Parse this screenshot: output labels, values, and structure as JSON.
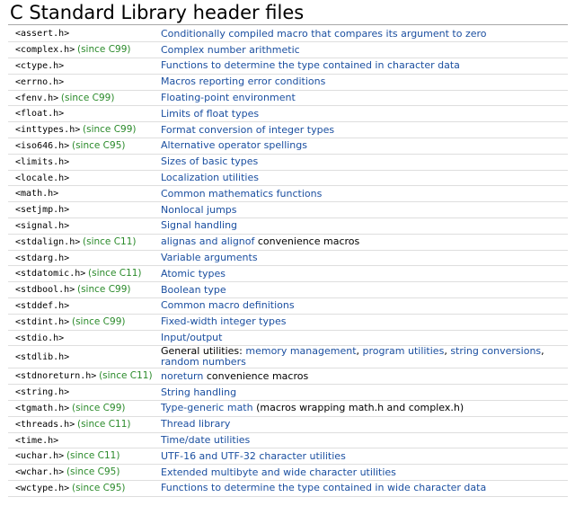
{
  "title": "C Standard Library header files",
  "colors": {
    "link": "#1b4fa0",
    "since": "#2a8a2a",
    "text": "#000000"
  },
  "headers": [
    {
      "name": "<assert.h>",
      "since": "",
      "desc": [
        {
          "t": "Conditionally compiled macro that compares its argument to zero",
          "link": true
        }
      ]
    },
    {
      "name": "<complex.h>",
      "since": "(since C99)",
      "desc": [
        {
          "t": "Complex number arithmetic",
          "link": true
        }
      ]
    },
    {
      "name": "<ctype.h>",
      "since": "",
      "desc": [
        {
          "t": "Functions to determine the type contained in character data",
          "link": true
        }
      ]
    },
    {
      "name": "<errno.h>",
      "since": "",
      "desc": [
        {
          "t": "Macros reporting error conditions",
          "link": true
        }
      ]
    },
    {
      "name": "<fenv.h>",
      "since": "(since C99)",
      "desc": [
        {
          "t": "Floating-point environment",
          "link": true
        }
      ]
    },
    {
      "name": "<float.h>",
      "since": "",
      "desc": [
        {
          "t": "Limits of float types",
          "link": true
        }
      ]
    },
    {
      "name": "<inttypes.h>",
      "since": "(since C99)",
      "desc": [
        {
          "t": "Format conversion of integer types",
          "link": true
        }
      ]
    },
    {
      "name": "<iso646.h>",
      "since": "(since C95)",
      "desc": [
        {
          "t": "Alternative operator spellings",
          "link": true
        }
      ]
    },
    {
      "name": "<limits.h>",
      "since": "",
      "desc": [
        {
          "t": "Sizes of basic types",
          "link": true
        }
      ]
    },
    {
      "name": "<locale.h>",
      "since": "",
      "desc": [
        {
          "t": "Localization utilities",
          "link": true
        }
      ]
    },
    {
      "name": "<math.h>",
      "since": "",
      "desc": [
        {
          "t": "Common mathematics functions",
          "link": true
        }
      ]
    },
    {
      "name": "<setjmp.h>",
      "since": "",
      "desc": [
        {
          "t": "Nonlocal jumps",
          "link": true
        }
      ]
    },
    {
      "name": "<signal.h>",
      "since": "",
      "desc": [
        {
          "t": "Signal handling",
          "link": true
        }
      ]
    },
    {
      "name": "<stdalign.h>",
      "since": "(since C11)",
      "desc": [
        {
          "t": "alignas and alignof",
          "link": true
        },
        {
          "t": " convenience macros",
          "link": false
        }
      ]
    },
    {
      "name": "<stdarg.h>",
      "since": "",
      "desc": [
        {
          "t": "Variable arguments",
          "link": true
        }
      ]
    },
    {
      "name": "<stdatomic.h>",
      "since": "(since C11)",
      "desc": [
        {
          "t": "Atomic types",
          "link": true
        }
      ]
    },
    {
      "name": "<stdbool.h>",
      "since": "(since C99)",
      "desc": [
        {
          "t": "Boolean type",
          "link": true
        }
      ]
    },
    {
      "name": "<stddef.h>",
      "since": "",
      "desc": [
        {
          "t": "Common macro definitions",
          "link": true
        }
      ]
    },
    {
      "name": "<stdint.h>",
      "since": "(since C99)",
      "desc": [
        {
          "t": "Fixed-width integer types",
          "link": true
        }
      ]
    },
    {
      "name": "<stdio.h>",
      "since": "",
      "desc": [
        {
          "t": "Input/output",
          "link": true
        }
      ]
    },
    {
      "name": "<stdlib.h>",
      "since": "",
      "tall": true,
      "desc": [
        {
          "t": "General utilities: ",
          "link": false
        },
        {
          "t": "memory management",
          "link": true
        },
        {
          "t": ", ",
          "link": false
        },
        {
          "t": "program utilities",
          "link": true
        },
        {
          "t": ", ",
          "link": false
        },
        {
          "t": "string conversions",
          "link": true
        },
        {
          "t": ", ",
          "link": false
        },
        {
          "t": "random numbers",
          "link": true
        }
      ]
    },
    {
      "name": "<stdnoreturn.h>",
      "since": "(since C11)",
      "desc": [
        {
          "t": "noreturn",
          "link": true
        },
        {
          "t": " convenience macros",
          "link": false
        }
      ]
    },
    {
      "name": "<string.h>",
      "since": "",
      "desc": [
        {
          "t": "String handling",
          "link": true
        }
      ]
    },
    {
      "name": "<tgmath.h>",
      "since": "(since C99)",
      "desc": [
        {
          "t": "Type-generic math",
          "link": true
        },
        {
          "t": " (macros wrapping math.h and complex.h)",
          "link": false
        }
      ]
    },
    {
      "name": "<threads.h>",
      "since": "(since C11)",
      "desc": [
        {
          "t": "Thread library",
          "link": true
        }
      ]
    },
    {
      "name": "<time.h>",
      "since": "",
      "desc": [
        {
          "t": "Time/date utilities",
          "link": true
        }
      ]
    },
    {
      "name": "<uchar.h>",
      "since": "(since C11)",
      "desc": [
        {
          "t": "UTF-16 and UTF-32 character utilities",
          "link": true
        }
      ]
    },
    {
      "name": "<wchar.h>",
      "since": "(since C95)",
      "desc": [
        {
          "t": "Extended multibyte and wide character utilities",
          "link": true
        }
      ]
    },
    {
      "name": "<wctype.h>",
      "since": "(since C95)",
      "desc": [
        {
          "t": "Functions to determine the type contained in wide character data",
          "link": true
        }
      ]
    }
  ]
}
